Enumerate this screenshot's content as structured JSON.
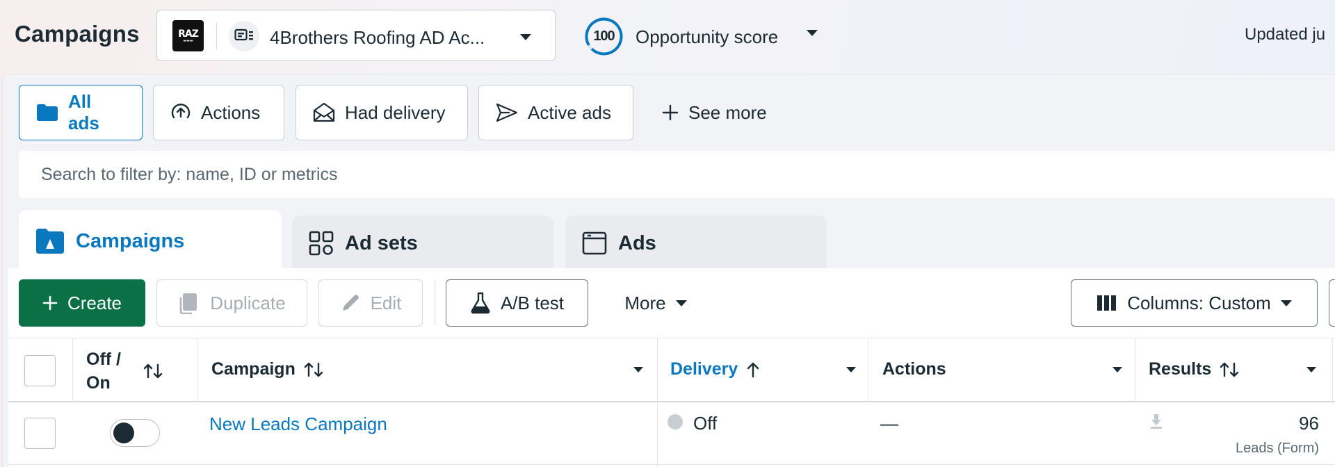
{
  "header": {
    "title": "Campaigns",
    "account": {
      "logo_text": "RAZ",
      "name": "4Brothers Roofing AD Ac..."
    },
    "opportunity": {
      "score": "100",
      "label": "Opportunity score"
    },
    "updated": "Updated ju"
  },
  "filters": [
    {
      "label": "All ads",
      "icon": "folder-icon",
      "active": true
    },
    {
      "label": "Actions",
      "icon": "arrow-up-circle-icon"
    },
    {
      "label": "Had delivery",
      "icon": "envelope-open-icon"
    },
    {
      "label": "Active ads",
      "icon": "send-icon"
    },
    {
      "label": "See more",
      "icon": "plus-icon"
    }
  ],
  "search": {
    "placeholder": "Search to filter by: name, ID or metrics"
  },
  "tabs": [
    {
      "label": "Campaigns",
      "icon": "campaign-folder-icon",
      "active": true
    },
    {
      "label": "Ad sets",
      "icon": "grid-icon"
    },
    {
      "label": "Ads",
      "icon": "ad-window-icon"
    }
  ],
  "toolbar": {
    "create": "Create",
    "duplicate": "Duplicate",
    "edit": "Edit",
    "ab_test": "A/B test",
    "more": "More",
    "columns": "Columns: Custom"
  },
  "table": {
    "columns": {
      "off_on": "Off / On",
      "campaign": "Campaign",
      "delivery": "Delivery",
      "actions": "Actions",
      "results": "Results"
    },
    "rows": [
      {
        "campaign": "New Leads Campaign",
        "delivery": "Off",
        "actions": "—",
        "results": "96",
        "results_type": "Leads (Form)"
      }
    ]
  },
  "colors": {
    "accent": "#0a78be",
    "primary_button": "#0b7046",
    "text": "#1c2b33"
  }
}
